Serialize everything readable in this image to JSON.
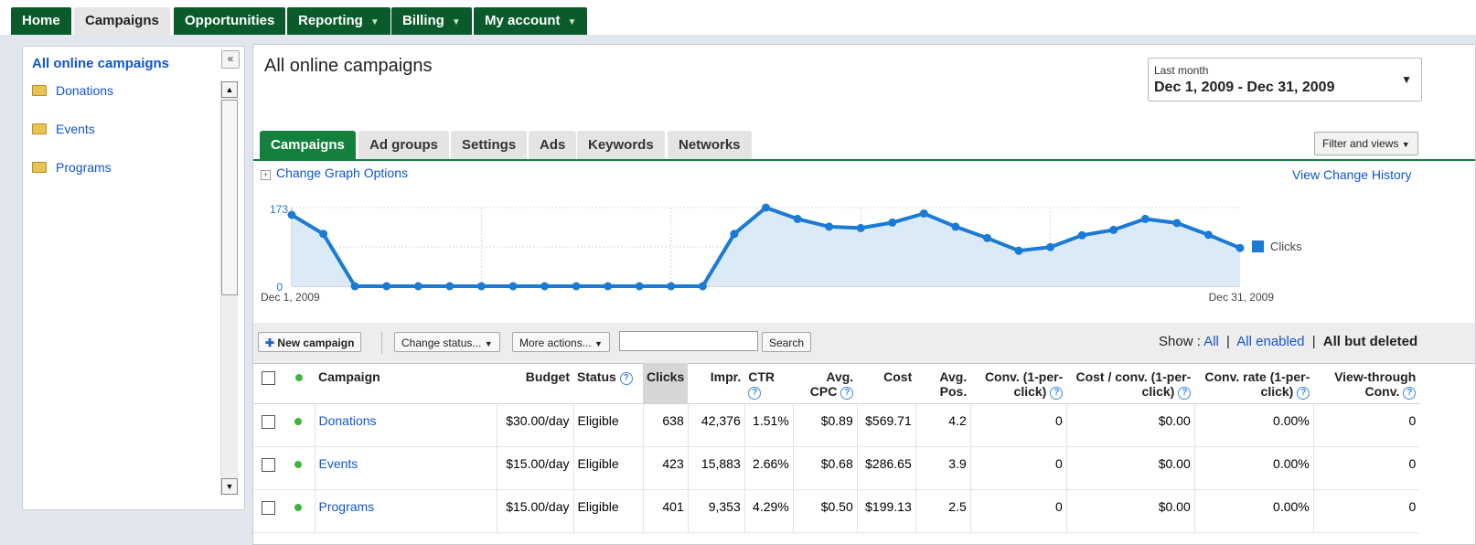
{
  "topnav": {
    "tabs": [
      {
        "label": "Home",
        "dropdown": false
      },
      {
        "label": "Campaigns",
        "dropdown": false,
        "active": true
      },
      {
        "label": "Opportunities",
        "dropdown": false
      },
      {
        "label": "Reporting",
        "dropdown": true
      },
      {
        "label": "Billing",
        "dropdown": true
      },
      {
        "label": "My account",
        "dropdown": true
      }
    ]
  },
  "sidebar": {
    "title": "All online campaigns",
    "collapse_glyph": "«",
    "items": [
      {
        "label": "Donations",
        "icon": "folder-icon"
      },
      {
        "label": "Events",
        "icon": "folder-icon"
      },
      {
        "label": "Programs",
        "icon": "folder-icon"
      }
    ]
  },
  "main": {
    "title": "All online campaigns",
    "date_range": {
      "label": "Last month",
      "value": "Dec 1, 2009 - Dec 31, 2009"
    },
    "tabs": [
      {
        "label": "Campaigns",
        "active": true
      },
      {
        "label": "Ad groups"
      },
      {
        "label": "Settings"
      },
      {
        "label": "Ads"
      },
      {
        "label": "Keywords"
      },
      {
        "label": "Networks"
      }
    ],
    "filter_label": "Filter and views",
    "change_graph_label": "Change Graph Options",
    "view_history_label": "View Change History"
  },
  "chart_data": {
    "type": "area",
    "x_start_label": "Dec 1, 2009",
    "x_end_label": "Dec 31, 2009",
    "y_ticks": [
      0,
      173
    ],
    "ylim": [
      0,
      173
    ],
    "series": [
      {
        "name": "Clicks",
        "color": "#1a7ad4",
        "values": [
          157,
          115,
          0,
          0,
          0,
          0,
          0,
          0,
          0,
          0,
          0,
          0,
          0,
          0,
          115,
          173,
          148,
          131,
          128,
          140,
          160,
          131,
          106,
          78,
          86,
          112,
          124,
          148,
          139,
          113,
          84
        ]
      }
    ]
  },
  "toolbar": {
    "new_campaign": "New campaign",
    "change_status": "Change status...",
    "more_actions": "More actions...",
    "search_button": "Search",
    "show_label": "Show :",
    "show_all": "All",
    "show_all_enabled": "All enabled",
    "show_all_but_deleted": "All but deleted"
  },
  "table": {
    "columns": {
      "campaign": "Campaign",
      "budget": "Budget",
      "status": "Status",
      "clicks": "Clicks",
      "impr": "Impr.",
      "ctr": "CTR",
      "avg_cpc_1": "Avg.",
      "avg_cpc_2": "CPC",
      "cost": "Cost",
      "avg_pos_1": "Avg.",
      "avg_pos_2": "Pos.",
      "conv_1": "Conv. (1-per-",
      "conv_2": "click)",
      "cost_conv_1": "Cost / conv. (1-per-",
      "cost_conv_2": "click)",
      "conv_rate_1": "Conv. rate (1-per-",
      "conv_rate_2": "click)",
      "view_1": "View-through",
      "view_2": "Conv."
    },
    "rows": [
      {
        "campaign": "Donations",
        "budget": "$30.00/day",
        "status": "Eligible",
        "clicks": "638",
        "impr": "42,376",
        "ctr": "1.51%",
        "avg_cpc": "$0.89",
        "cost": "$569.71",
        "avg_pos": "4.2",
        "conv": "0",
        "cost_conv": "$0.00",
        "conv_rate": "0.00%",
        "view_through": "0"
      },
      {
        "campaign": "Events",
        "budget": "$15.00/day",
        "status": "Eligible",
        "clicks": "423",
        "impr": "15,883",
        "ctr": "2.66%",
        "avg_cpc": "$0.68",
        "cost": "$286.65",
        "avg_pos": "3.9",
        "conv": "0",
        "cost_conv": "$0.00",
        "conv_rate": "0.00%",
        "view_through": "0"
      },
      {
        "campaign": "Programs",
        "budget": "$15.00/day",
        "status": "Eligible",
        "clicks": "401",
        "impr": "9,353",
        "ctr": "4.29%",
        "avg_cpc": "$0.50",
        "cost": "$199.13",
        "avg_pos": "2.5",
        "conv": "0",
        "cost_conv": "$0.00",
        "conv_rate": "0.00%",
        "view_through": "0"
      }
    ]
  }
}
